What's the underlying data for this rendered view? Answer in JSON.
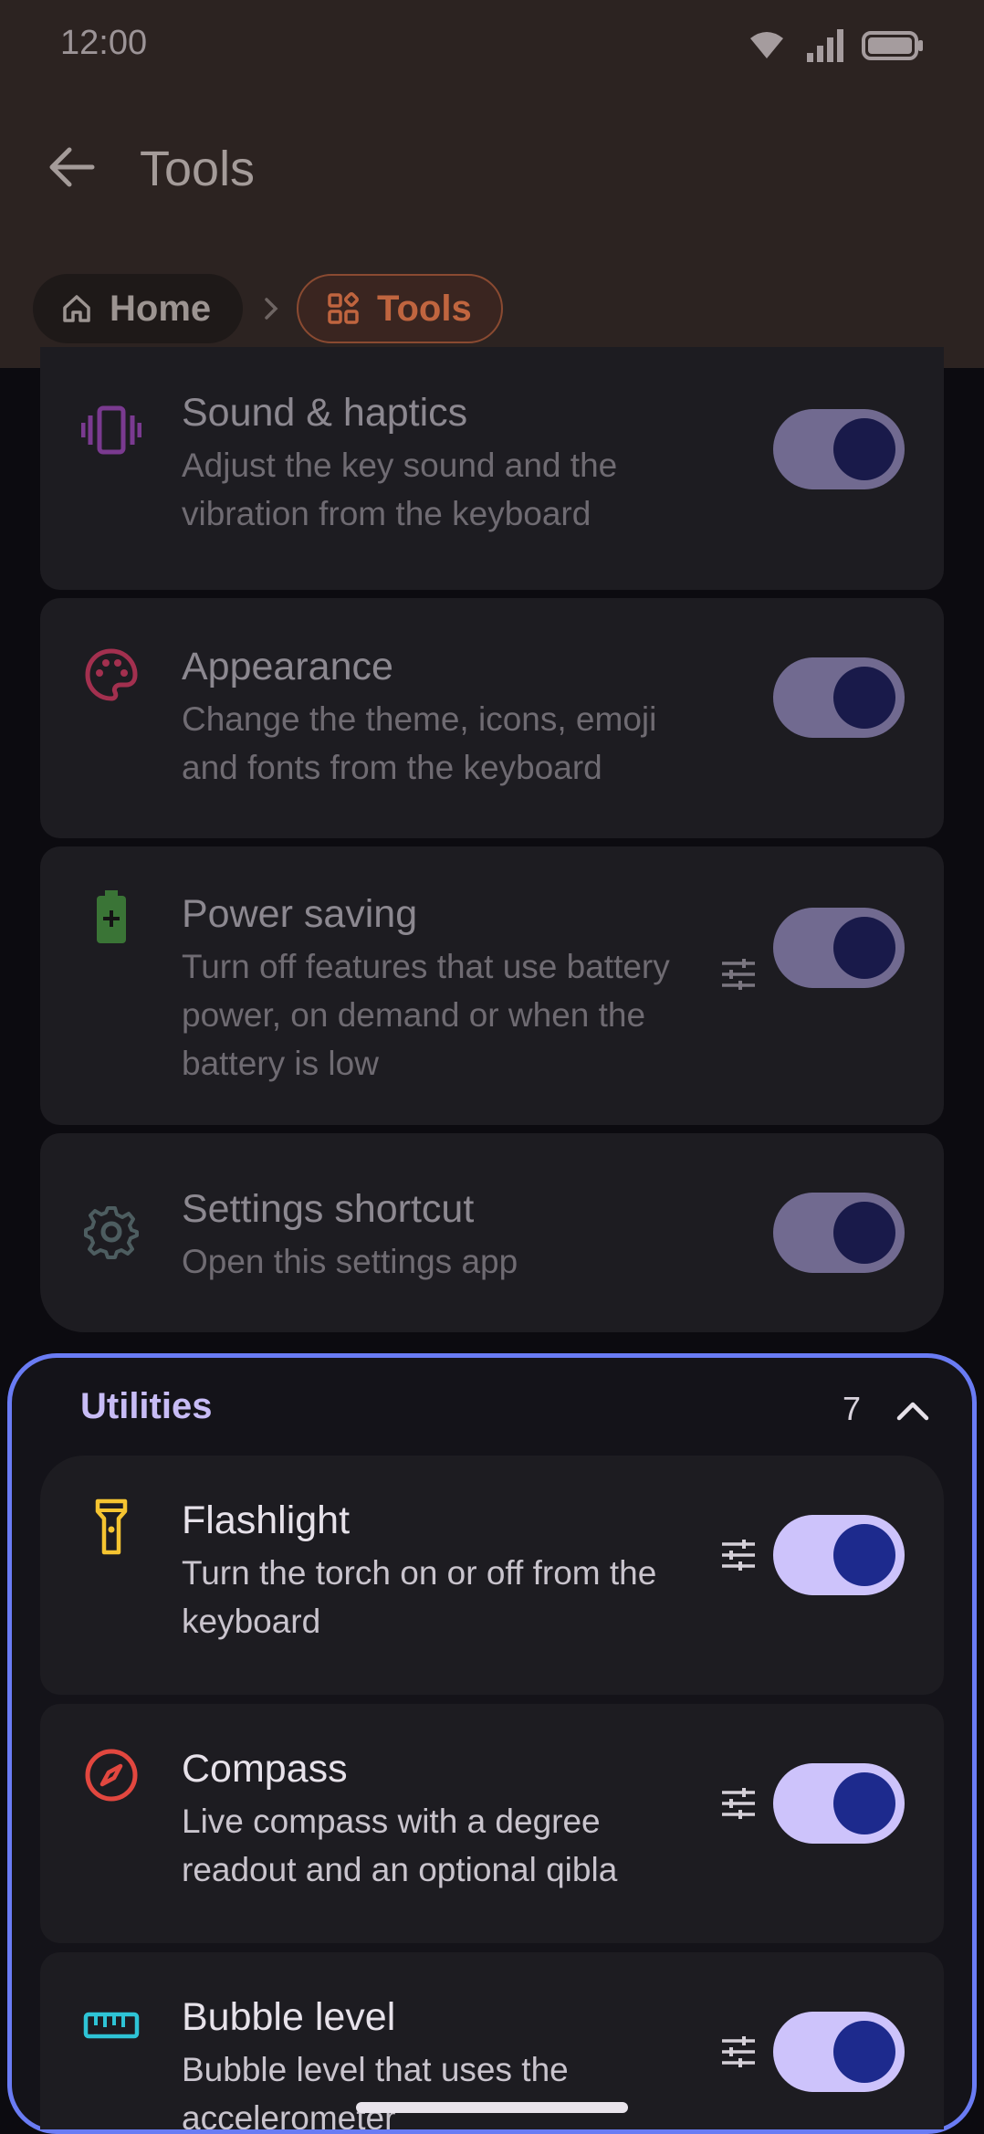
{
  "status_bar": {
    "time": "12:00",
    "icons": [
      "wifi-icon",
      "signal-icon",
      "battery-icon"
    ]
  },
  "app_bar": {
    "title": "Tools",
    "back_icon": "arrow-left-icon"
  },
  "breadcrumb": {
    "items": [
      {
        "label": "Home",
        "icon": "home-icon"
      },
      {
        "label": "Tools",
        "icon": "grid-icon",
        "active": true
      }
    ],
    "separator_icon": "chevron-right-icon"
  },
  "cards_above": [
    {
      "title": "Sound & haptics",
      "description": "Adjust the key sound and the vibration from the keyboard",
      "icon": "vibration-icon",
      "icon_color": "#9c3ec0",
      "enabled": true,
      "has_settings": false
    },
    {
      "title": "Appearance",
      "description": "Change the theme, icons, emoji and fonts from the keyboard",
      "icon": "palette-icon",
      "icon_color": "#c8335e",
      "enabled": true,
      "has_settings": false
    },
    {
      "title": "Power saving",
      "description": "Turn off features that use battery power, on demand or when the battery is low",
      "icon": "battery-plus-icon",
      "icon_color": "#3f8b3c",
      "enabled": true,
      "has_settings": true
    },
    {
      "title": "Settings shortcut",
      "description": "Open this settings app",
      "icon": "gear-icon",
      "icon_color": "#4f6064",
      "enabled": true,
      "has_settings": false
    }
  ],
  "utilities": {
    "title": "Utilities",
    "count": "7",
    "expanded": true,
    "cards": [
      {
        "title": "Flashlight",
        "description": "Turn the torch on or off from the keyboard",
        "icon": "flashlight-icon",
        "icon_color": "#f5c431",
        "enabled": true,
        "has_settings": true
      },
      {
        "title": "Compass",
        "description": "Live compass with a degree readout and an optional qibla",
        "icon": "compass-icon",
        "icon_color": "#e2473f",
        "enabled": true,
        "has_settings": true
      },
      {
        "title": "Bubble level",
        "description": "Bubble level that uses the accelerometer",
        "icon": "ruler-icon",
        "icon_color": "#2ec4d6",
        "enabled": true,
        "has_settings": true
      }
    ]
  },
  "colors": {
    "header_bg": "#2c2321",
    "accent": "#c0653f",
    "toggle_on": "#cdc3fb",
    "section_border": "#6a7cf4"
  }
}
